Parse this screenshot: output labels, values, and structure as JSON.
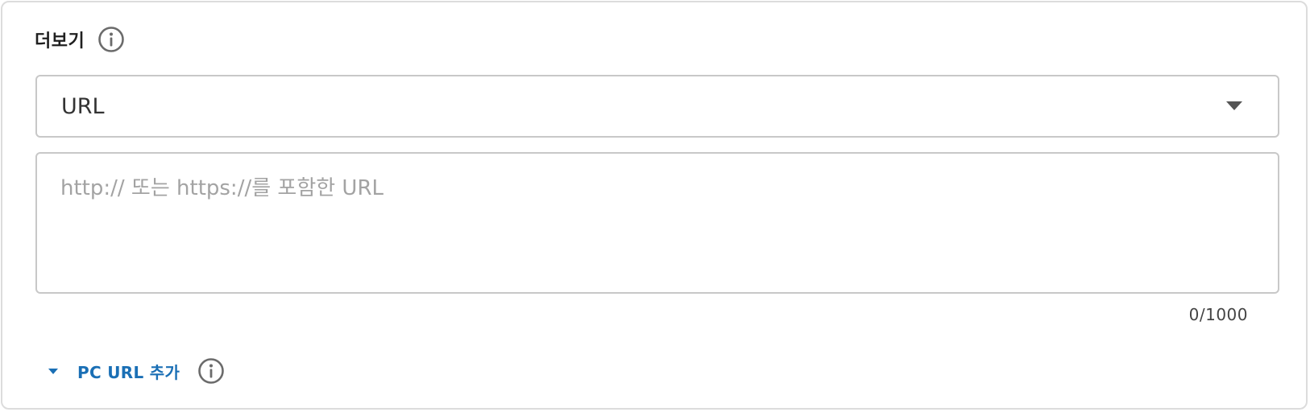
{
  "section": {
    "title": "더보기",
    "info_icon": "info-icon"
  },
  "link_type_select": {
    "selected": "URL",
    "caret_icon": "caret-down-icon"
  },
  "url_input": {
    "placeholder": "http:// 또는 https://를 포함한 URL",
    "value": "",
    "counter": "0/1000"
  },
  "pc_url_toggle": {
    "label": "PC URL 추가",
    "caret_icon": "caret-down-icon",
    "info_icon": "info-icon",
    "accent_color": "#1a6fb5"
  }
}
